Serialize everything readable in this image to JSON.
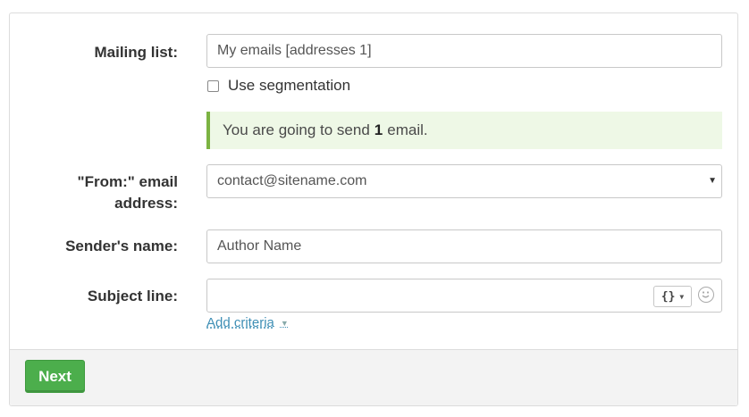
{
  "form": {
    "mailing_list": {
      "label": "Mailing list:",
      "value": "My emails [addresses 1]"
    },
    "segmentation": {
      "label": "Use segmentation",
      "checked": false
    },
    "alert": {
      "prefix": "You are going to send",
      "count": "1",
      "suffix": "email."
    },
    "from_address": {
      "label_line1": "\"From:\" email",
      "label_line2": "address:",
      "value": "contact@sitename.com"
    },
    "sender_name": {
      "label": "Sender's name:",
      "value": "Author Name"
    },
    "subject_line": {
      "label": "Subject line:",
      "value": "",
      "token_button": "{}"
    },
    "add_criteria": "Add criteria"
  },
  "footer": {
    "next_label": "Next"
  },
  "colors": {
    "primary_button": "#4cae4c",
    "alert_bg": "#eef8e6",
    "alert_border": "#7cb342",
    "link": "#3f8fb5"
  }
}
